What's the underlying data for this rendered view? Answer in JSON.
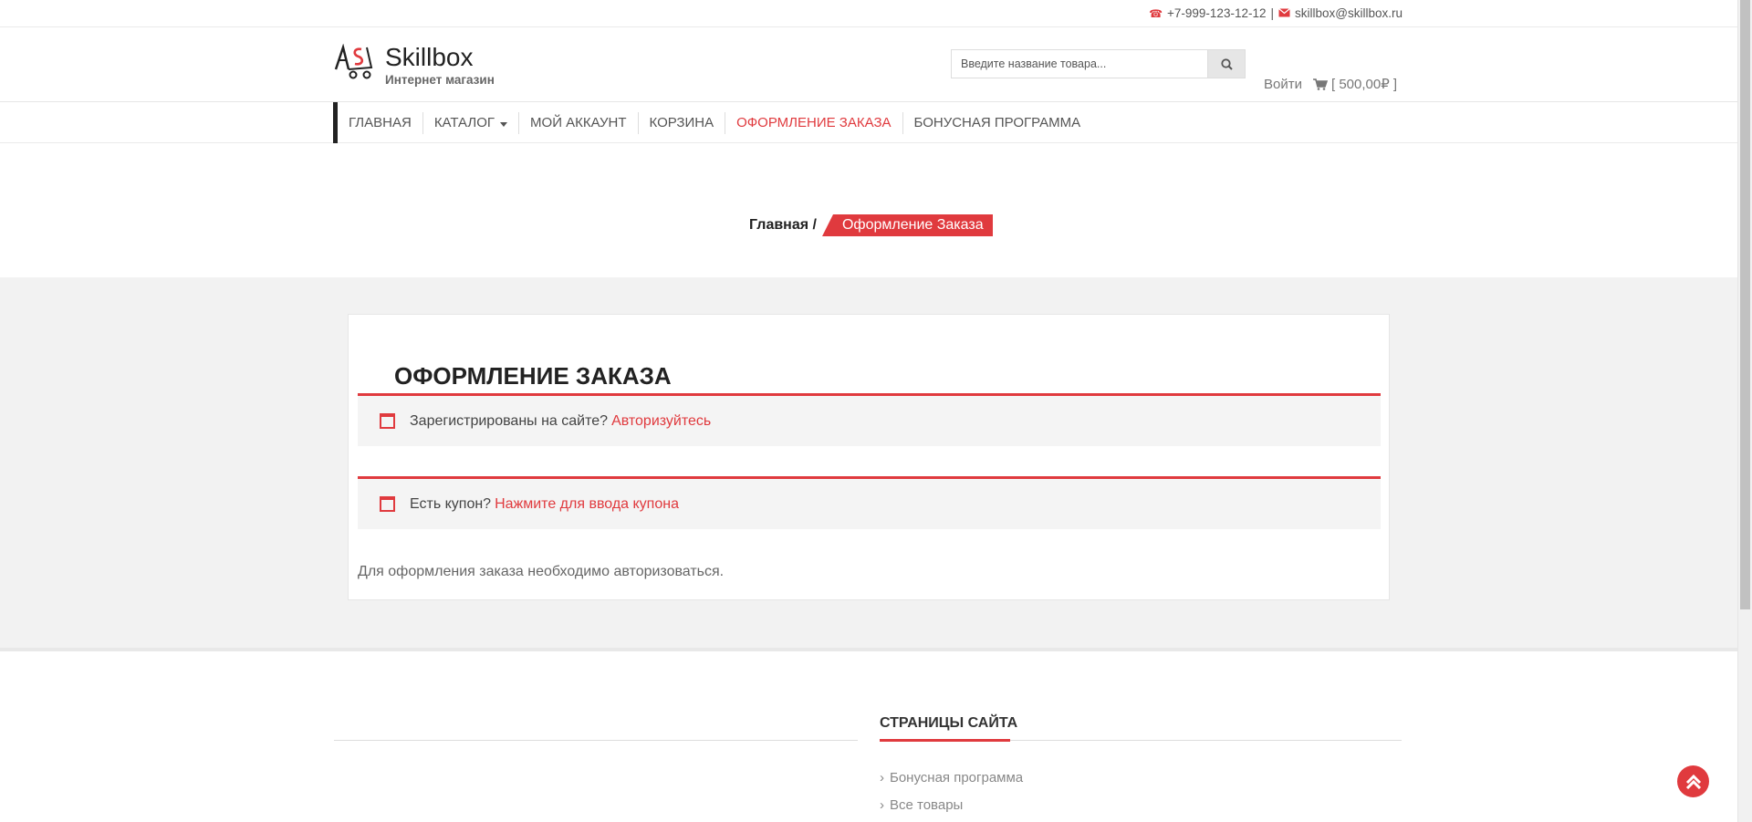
{
  "topbar": {
    "phone": "+7-999-123-12-12",
    "separator": "|",
    "email": "skillbox@skillbox.ru"
  },
  "logo": {
    "name": "Skillbox",
    "tagline": "Интернет магазин"
  },
  "search": {
    "placeholder": "Введите название товара..."
  },
  "account": {
    "login_label": "Войти",
    "cart_label": "[ 500,00₽ ]"
  },
  "nav": {
    "items": [
      {
        "label": "ГЛАВНАЯ"
      },
      {
        "label": "КАТАЛОГ"
      },
      {
        "label": "МОЙ АККАУНТ"
      },
      {
        "label": "КОРЗИНА"
      },
      {
        "label": "ОФОРМЛЕНИЕ ЗАКАЗА"
      },
      {
        "label": "БОНУСНАЯ ПРОГРАММА"
      }
    ],
    "active_index": 4
  },
  "breadcrumb": {
    "home": "Главная /",
    "current": "Оформление Заказа"
  },
  "checkout": {
    "title": "ОФОРМЛЕНИЕ ЗАКАЗА",
    "login_notice": {
      "text": "Зарегистрированы на сайте?",
      "link": "Авторизуйтесь"
    },
    "coupon_notice": {
      "text": "Есть купон?",
      "link": "Нажмите для ввода купона"
    },
    "auth_required": "Для оформления заказа необходимо авторизоваться."
  },
  "footer": {
    "pages_title": "СТРАНИЦЫ САЙТА",
    "pages": [
      {
        "label": "Бонусная программа"
      },
      {
        "label": "Все товары"
      }
    ]
  },
  "colors": {
    "accent": "#e03a3e",
    "background_gray": "#f2f2f2"
  },
  "icons": [
    "phone-icon",
    "envelope-icon",
    "search-icon",
    "cart-icon",
    "calendar-icon",
    "chevron-right-icon",
    "chevron-up-icon"
  ]
}
